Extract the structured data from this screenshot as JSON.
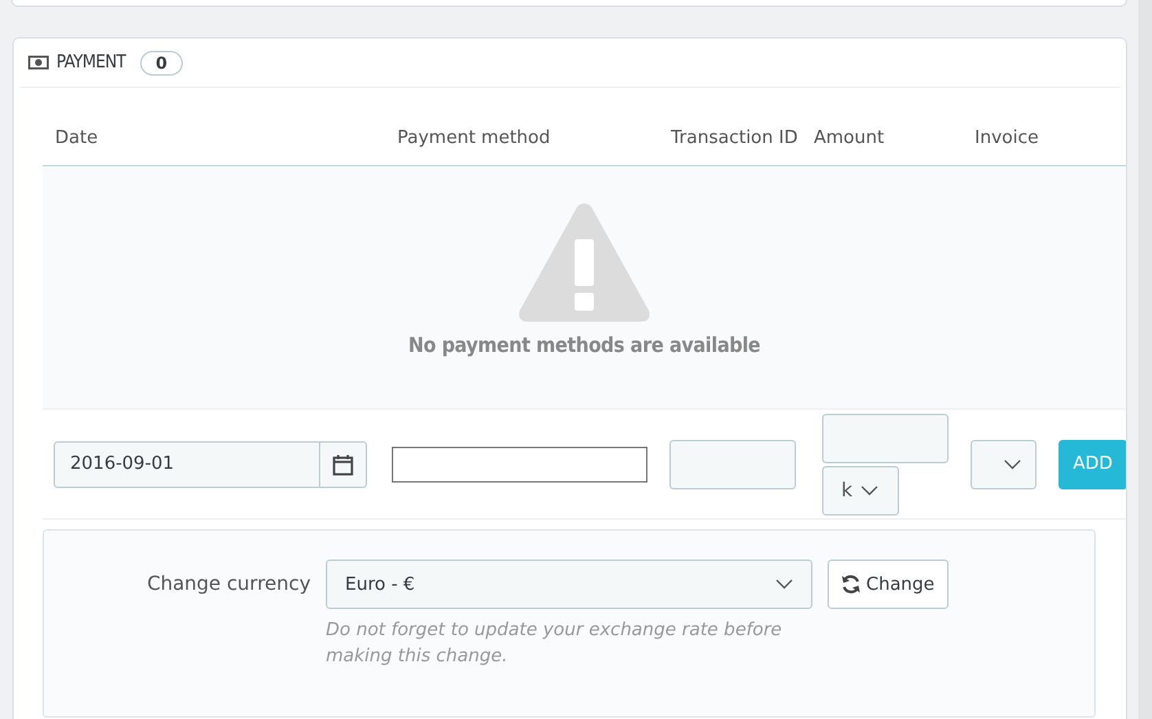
{
  "panel": {
    "title": "PAYMENT",
    "count": "0"
  },
  "table": {
    "columns": [
      "Date",
      "Payment method",
      "Transaction ID",
      "Amount",
      "Invoice"
    ],
    "empty_message": "No payment methods are available"
  },
  "form": {
    "date": "2016-09-01",
    "currency_select": "k",
    "add_button": "ADD"
  },
  "currency": {
    "label": "Change currency",
    "select": "Euro - €",
    "button": "Change",
    "help": "Do not forget to update your exchange rate before making this change."
  }
}
